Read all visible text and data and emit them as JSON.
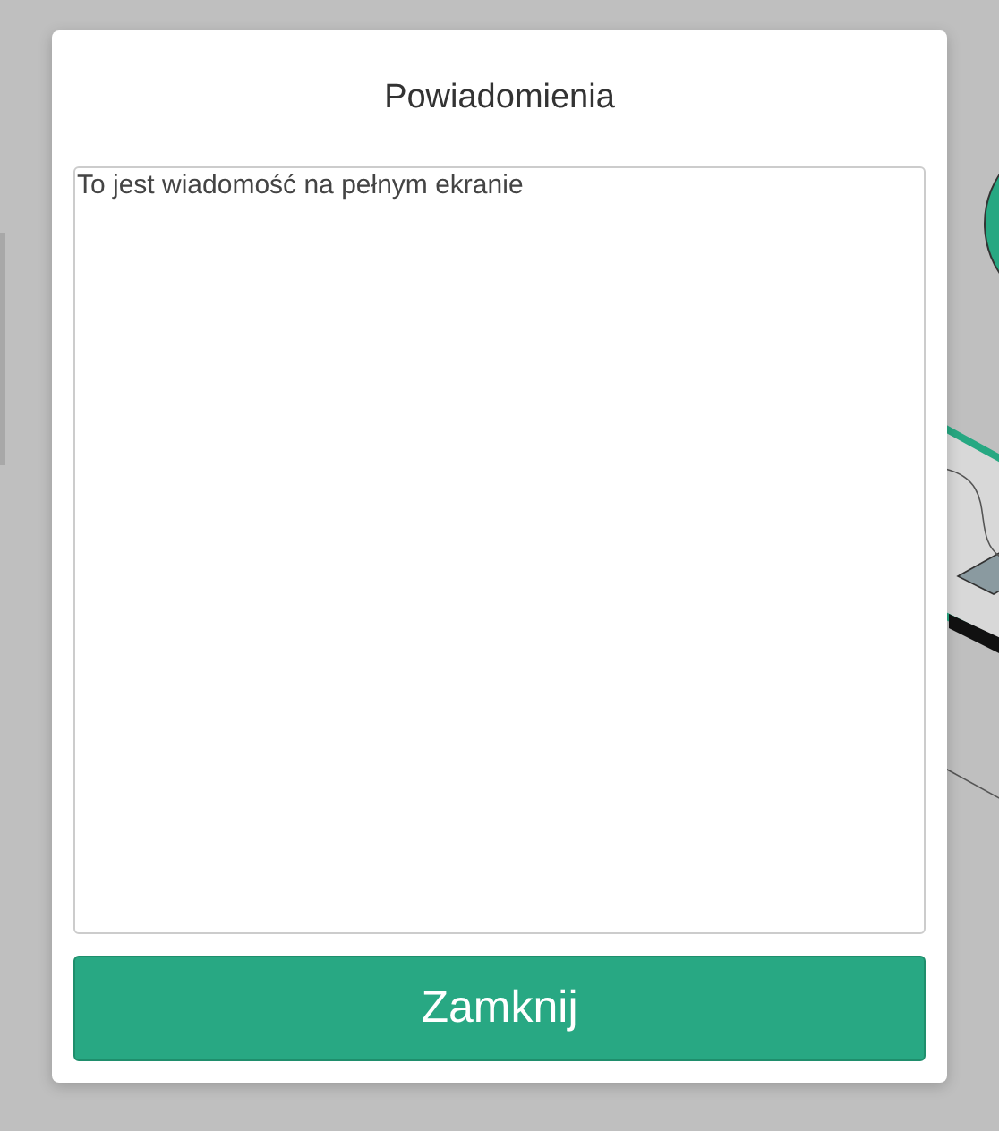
{
  "dialog": {
    "title": "Powiadomienia",
    "message": {
      "value": "To jest wiadomość na pełnym ekranie"
    },
    "buttons": [
      {
        "label": "Zamknij",
        "kind": "primary"
      }
    ]
  }
}
